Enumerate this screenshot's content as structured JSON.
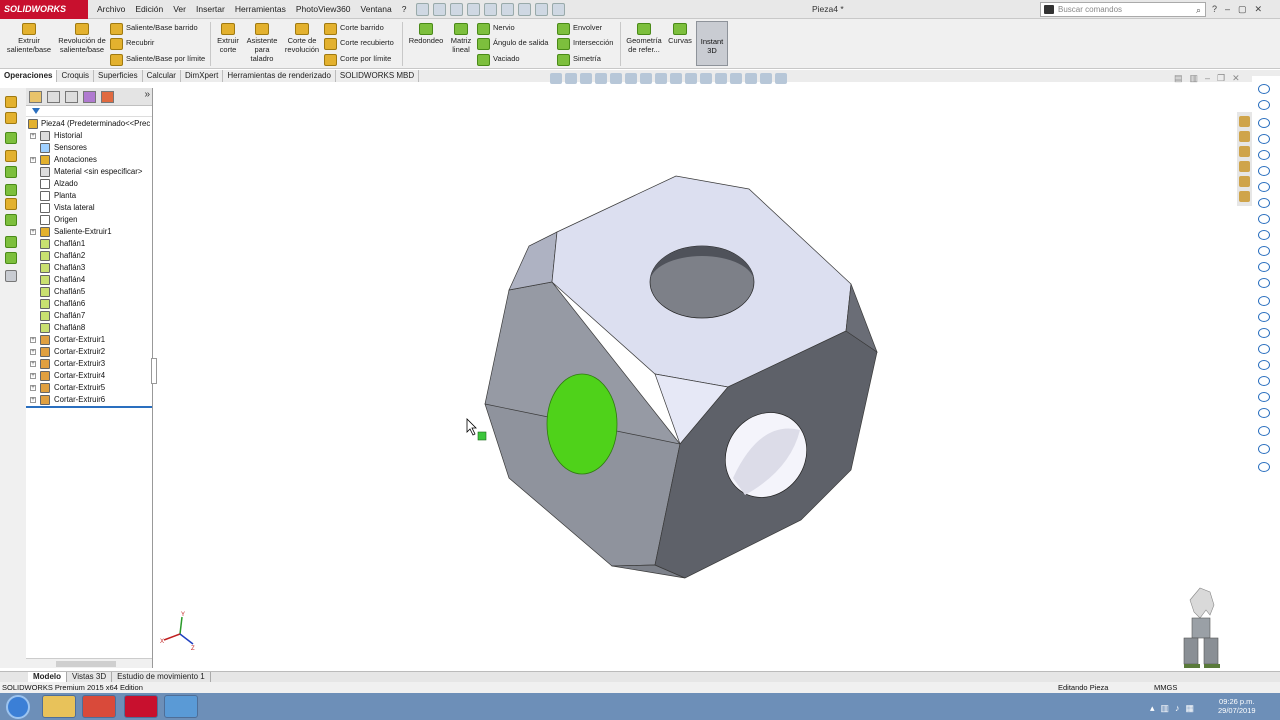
{
  "app": {
    "logo_text": "SOLIDWORKS",
    "window_title": "Pieza4 *"
  },
  "menu": [
    "Archivo",
    "Edición",
    "Ver",
    "Insertar",
    "Herramientas",
    "PhotoView360",
    "Ventana",
    "?"
  ],
  "search": {
    "placeholder": "Buscar comandos"
  },
  "window_controls": [
    "?",
    "–",
    "▢",
    "✕"
  ],
  "ribbon": {
    "extrude_boss": "Extruir saliente/base",
    "revolve_boss": "Revolución de saliente/base",
    "swept_boss": "Saliente/Base barrido",
    "loft": "Recubrir",
    "boundary_boss": "Saliente/Base por límite",
    "extrude_cut": "Extruir corte",
    "hole_wizard": "Asistente para taladro",
    "revolve_cut": "Corte de revolución",
    "swept_cut": "Corte barrido",
    "lofted_cut": "Corte recubierto",
    "boundary_cut": "Corte por límite",
    "fillet": "Redondeo",
    "linear_pattern": "Matriz lineal",
    "rib": "Nervio",
    "draft": "Ángulo de salida",
    "shell": "Vaciado",
    "wrap": "Envolver",
    "intersect": "Intersección",
    "mirror": "Simetría",
    "ref_geometry": "Geometría de refer...",
    "curves": "Curvas",
    "instant3d": "Instant 3D"
  },
  "tabs": [
    "Operaciones",
    "Croquis",
    "Superficies",
    "Calcular",
    "DimXpert",
    "Herramientas de renderizado",
    "SOLIDWORKS MBD"
  ],
  "tree": {
    "root": "Pieza4  (Predeterminado<<Prec",
    "items": [
      "Historial",
      "Sensores",
      "Anotaciones",
      "Material <sin especificar>",
      "Alzado",
      "Planta",
      "Vista lateral",
      "Origen",
      "Saliente-Extruir1",
      "Chaflán1",
      "Chaflán2",
      "Chaflán3",
      "Chaflán4",
      "Chaflán5",
      "Chaflán6",
      "Chaflán7",
      "Chaflán8",
      "Cortar-Extruir1",
      "Cortar-Extruir2",
      "Cortar-Extruir3",
      "Cortar-Extruir4",
      "Cortar-Extruir5",
      "Cortar-Extruir6"
    ]
  },
  "bottom_tabs": [
    "Modelo",
    "Vistas 3D",
    "Estudio de movimiento 1"
  ],
  "status": {
    "left": "SOLIDWORKS Premium 2015 x64 Edition",
    "mode": "Editando Pieza",
    "units": "MMGS"
  },
  "triad": {
    "x": "X",
    "y": "Y",
    "z": "Z"
  },
  "clock": {
    "time": "09:26 p.m.",
    "date": "29/07/2019"
  },
  "colors": {
    "brand": "#c8102e",
    "selected_face": "#4fd21a",
    "tree_accent": "#2a6fbf"
  }
}
